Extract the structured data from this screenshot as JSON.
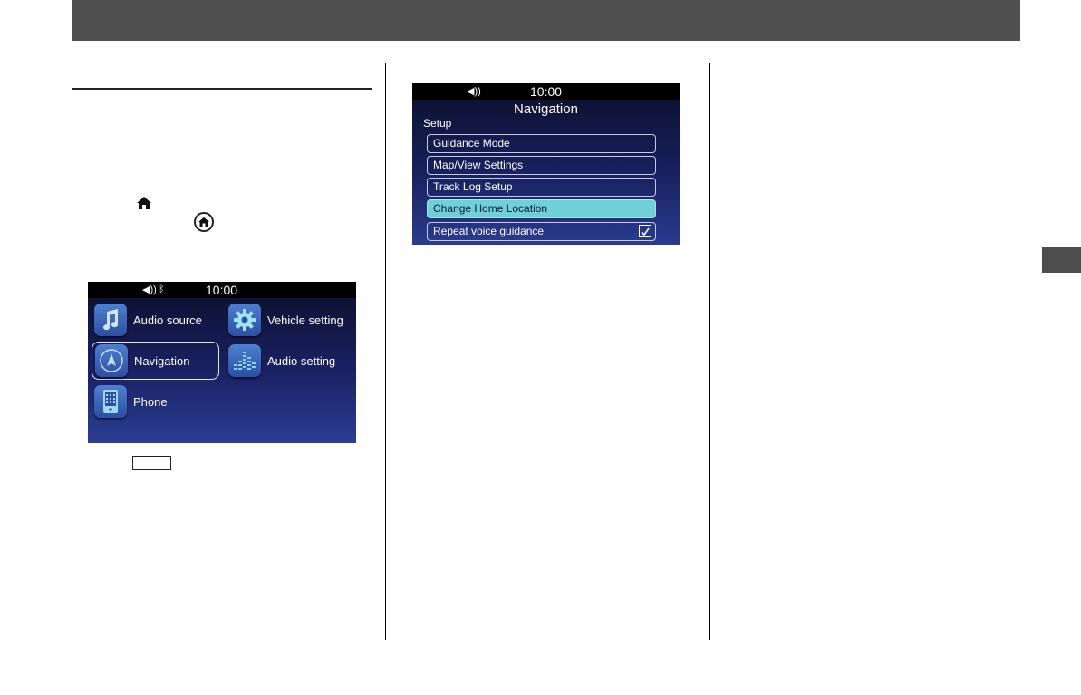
{
  "home_screen": {
    "status": {
      "time": "10:00",
      "sound_icon": "speaker-icon",
      "bluetooth_icon": "bluetooth-icon"
    },
    "items": [
      {
        "label": "Audio source",
        "icon": "music-note-icon"
      },
      {
        "label": "Vehicle setting",
        "icon": "gear-icon"
      },
      {
        "label": "Navigation",
        "icon": "navigation-arrow-icon",
        "selected": true
      },
      {
        "label": "Audio setting",
        "icon": "equalizer-icon"
      },
      {
        "label": "Phone",
        "icon": "phone-icon"
      }
    ]
  },
  "nav_screen": {
    "status": {
      "time": "10:00",
      "sound_icon": "speaker-icon"
    },
    "title": "Navigation",
    "section": "Setup",
    "rows": [
      {
        "label": "Guidance Mode"
      },
      {
        "label": "Map/View Settings"
      },
      {
        "label": "Track Log Setup"
      },
      {
        "label": "Change Home Location",
        "highlighted": true
      },
      {
        "label": "Repeat voice guidance",
        "checked": true
      }
    ]
  },
  "colors": {
    "header": "#505050",
    "highlight": "#6fd0d6",
    "screen_top": "#0b0f2a",
    "screen_bottom": "#2b3d93"
  }
}
